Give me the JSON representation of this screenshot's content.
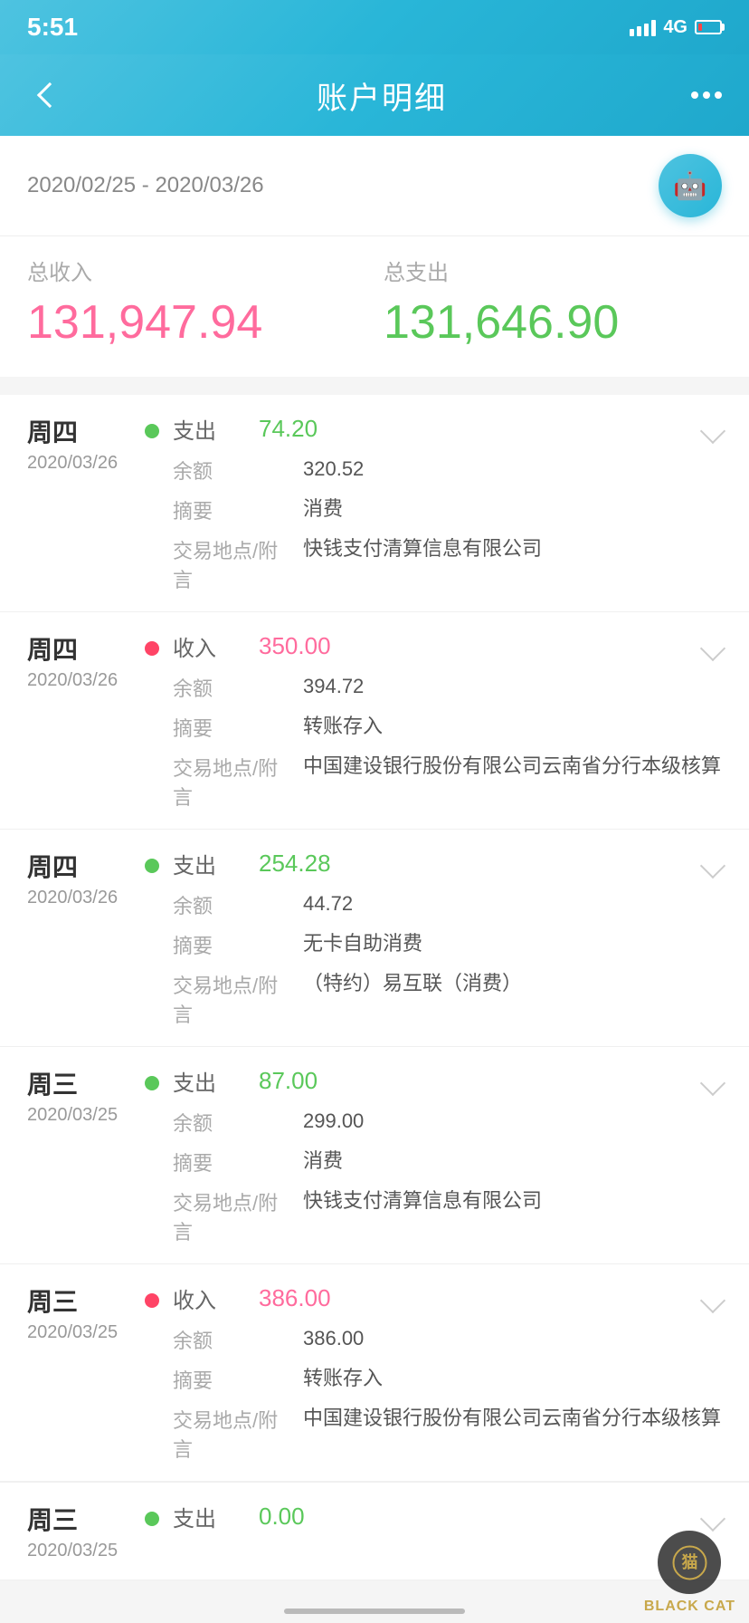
{
  "statusBar": {
    "time": "5:51",
    "network": "4G"
  },
  "header": {
    "back_label": "back",
    "title": "账户明细",
    "more_label": "more"
  },
  "dateRange": {
    "text": "2020/02/25 - 2020/03/26"
  },
  "summary": {
    "income_label": "总收入",
    "expense_label": "总支出",
    "income_amount": "131,947.94",
    "expense_amount": "131,646.90"
  },
  "transactions": [
    {
      "day_name": "周四",
      "date": "2020/03/26",
      "type": "支出",
      "dot_type": "green",
      "amount": "74.20",
      "balance_label": "余额",
      "balance": "320.52",
      "summary_label": "摘要",
      "summary": "消费",
      "location_label": "交易地点/附言",
      "location": "快钱支付清算信息有限公司"
    },
    {
      "day_name": "周四",
      "date": "2020/03/26",
      "type": "收入",
      "dot_type": "red",
      "amount": "350.00",
      "balance_label": "余额",
      "balance": "394.72",
      "summary_label": "摘要",
      "summary": "转账存入",
      "location_label": "交易地点/附言",
      "location": "中国建设银行股份有限公司云南省分行本级核算"
    },
    {
      "day_name": "周四",
      "date": "2020/03/26",
      "type": "支出",
      "dot_type": "green",
      "amount": "254.28",
      "balance_label": "余额",
      "balance": "44.72",
      "summary_label": "摘要",
      "summary": "无卡自助消费",
      "location_label": "交易地点/附言",
      "location": "（特约）易互联（消费）"
    },
    {
      "day_name": "周三",
      "date": "2020/03/25",
      "type": "支出",
      "dot_type": "green",
      "amount": "87.00",
      "balance_label": "余额",
      "balance": "299.00",
      "summary_label": "摘要",
      "summary": "消费",
      "location_label": "交易地点/附言",
      "location": "快钱支付清算信息有限公司"
    },
    {
      "day_name": "周三",
      "date": "2020/03/25",
      "type": "收入",
      "dot_type": "red",
      "amount": "386.00",
      "balance_label": "余额",
      "balance": "386.00",
      "summary_label": "摘要",
      "summary": "转账存入",
      "location_label": "交易地点/附言",
      "location": "中国建设银行股份有限公司云南省分行本级核算"
    }
  ],
  "lastPartialItem": {
    "day_name": "周三",
    "date": "2020/03/25",
    "type": "支出",
    "dot_type": "green",
    "amount": "0.00"
  },
  "blackCat": {
    "label": "BLACK CAT"
  },
  "colors": {
    "header_bg": "#3bbfd8",
    "income": "#ff6b9d",
    "expense": "#5ac85a",
    "income_amount": "#ff6b9d",
    "expense_amount": "#5ac85a"
  }
}
